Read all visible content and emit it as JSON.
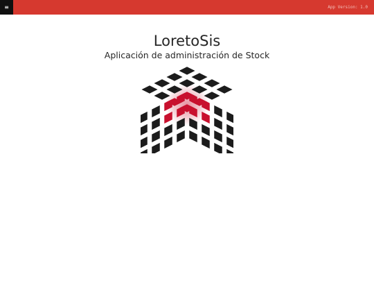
{
  "header": {
    "menu_icon": "hamburger-icon",
    "menu_glyph": "≡",
    "version_text": "App Version: 1.0",
    "background_color": "#d6392f",
    "menu_background_color": "#101010"
  },
  "main": {
    "title": "LoretoSis",
    "subtitle": "Aplicación de administración de Stock",
    "logo": {
      "icon": "cube-grid-logo",
      "tile_color": "#1c1c1c",
      "highlight_color": "#c8102e"
    }
  }
}
